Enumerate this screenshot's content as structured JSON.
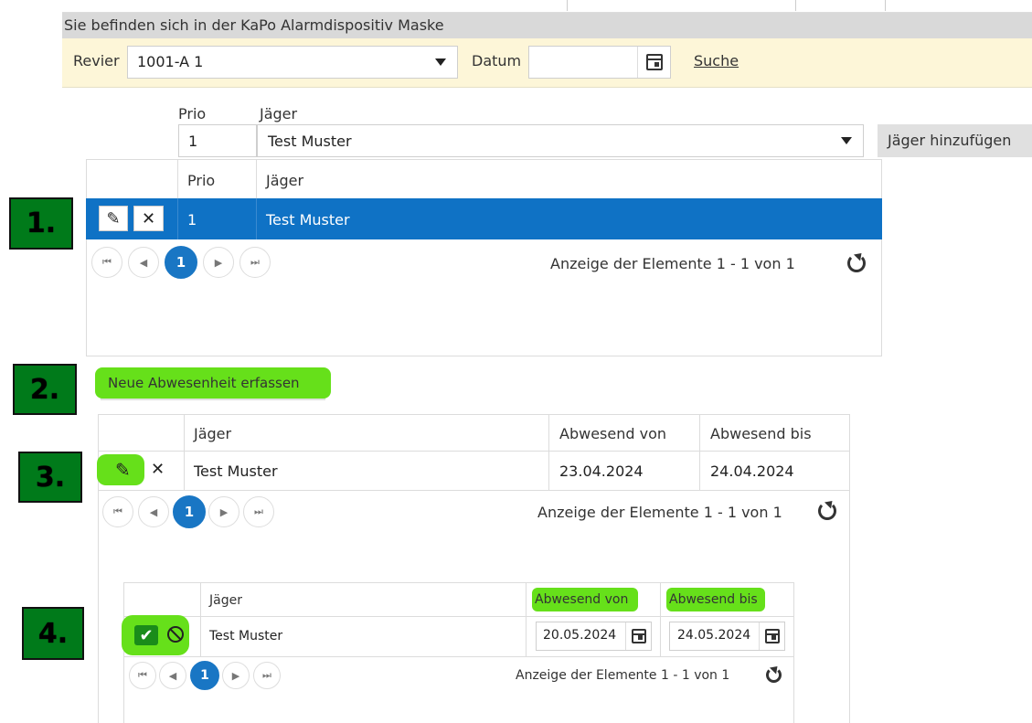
{
  "header": {
    "title": "Sie befinden sich in der KaPo Alarmdispositiv Maske"
  },
  "search": {
    "revier_label": "Revier",
    "revier_value": "1001-A 1",
    "datum_label": "Datum",
    "datum_value": "",
    "search_link": "Suche"
  },
  "add_form": {
    "prio_label": "Prio",
    "jaeger_label": "Jäger",
    "prio_value": "1",
    "jaeger_value": "Test Muster",
    "add_button": "Jäger hinzufügen"
  },
  "grid1": {
    "columns": [
      "Prio",
      "Jäger"
    ],
    "row": {
      "prio": "1",
      "jaeger": "Test Muster"
    },
    "page": "1",
    "pager_info": "Anzeige der Elemente 1 - 1 von 1"
  },
  "new_absence_button": "Neue Abwesenheit erfassen",
  "grid2": {
    "columns": [
      "Jäger",
      "Abwesend von",
      "Abwesend bis"
    ],
    "row": {
      "jaeger": "Test Muster",
      "von": "23.04.2024",
      "bis": "24.04.2024"
    },
    "page": "1",
    "pager_info": "Anzeige der Elemente 1 - 1 von 1"
  },
  "grid3": {
    "columns": [
      "Jäger",
      "Abwesend von",
      "Abwesend bis"
    ],
    "row": {
      "jaeger": "Test Muster",
      "von": "20.05.2024",
      "bis": "24.05.2024"
    },
    "page": "1",
    "pager_info": "Anzeige der Elemente 1 - 1 von 1"
  },
  "markers": [
    "1.",
    "2.",
    "3.",
    "4."
  ],
  "colors": {
    "selected_row": "#0f72c5",
    "highlight": "#66e01a",
    "marker": "#007a1a",
    "search_bg": "#fdf6d8"
  }
}
